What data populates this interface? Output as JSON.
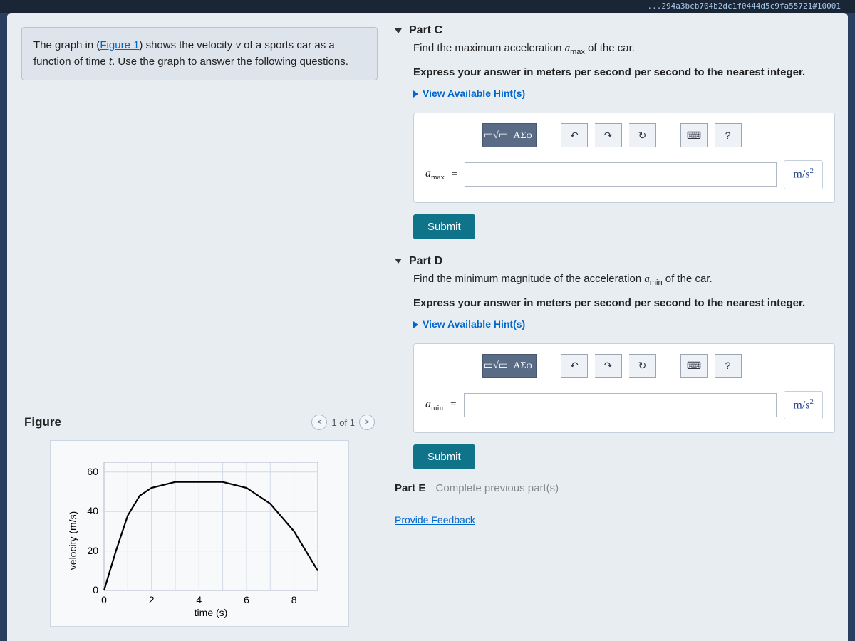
{
  "url_fragment": "...294a3bcb704b2dc1f0444d5c9fa55721#10001",
  "problem": {
    "prefix": "The graph in (",
    "figure_link": "Figure 1",
    "mid": ") shows the velocity ",
    "var_v": "v",
    "mid2": " of a sports car as a function of time ",
    "var_t": "t",
    "suffix": ". Use the graph to answer the following questions."
  },
  "figure": {
    "title": "Figure",
    "counter": "1 of 1",
    "ylabel": "velocity (m/s)",
    "xlabel": "time (s)",
    "y_ticks": [
      "0",
      "20",
      "40",
      "60"
    ],
    "x_ticks": [
      "0",
      "2",
      "4",
      "6",
      "8"
    ]
  },
  "chart_data": {
    "type": "line",
    "xlabel": "time (s)",
    "ylabel": "velocity (m/s)",
    "xlim": [
      0,
      9
    ],
    "ylim": [
      0,
      65
    ],
    "series": [
      {
        "name": "velocity",
        "x": [
          0,
          0.5,
          1,
          1.5,
          2,
          3,
          4,
          5,
          6,
          7,
          8,
          9
        ],
        "y": [
          0,
          20,
          38,
          48,
          52,
          55,
          55,
          55,
          52,
          44,
          30,
          10
        ]
      }
    ]
  },
  "parts": {
    "c": {
      "label": "Part C",
      "prompt_pre": "Find the maximum acceleration ",
      "prompt_var": "a",
      "prompt_sub": "max",
      "prompt_post": " of the car.",
      "instruct": "Express your answer in meters per second per second to the nearest integer.",
      "hint": "View Available Hint(s)",
      "var_label": "a",
      "var_sub": "max",
      "eq": "=",
      "unit": "m/s",
      "unit_sup": "2",
      "submit": "Submit"
    },
    "d": {
      "label": "Part D",
      "prompt_pre": "Find the minimum magnitude of the acceleration ",
      "prompt_var": "a",
      "prompt_sub": "min",
      "prompt_post": " of the car.",
      "instruct": "Express your answer in meters per second per second to the nearest integer.",
      "hint": "View Available Hint(s)",
      "var_label": "a",
      "var_sub": "min",
      "eq": "=",
      "unit": "m/s",
      "unit_sup": "2",
      "submit": "Submit"
    },
    "e": {
      "label": "Part E",
      "msg": "Complete previous part(s)"
    }
  },
  "toolbar": {
    "templates": "▭√▭",
    "greek": "ΑΣφ",
    "undo": "↶",
    "redo": "↷",
    "reset": "↻",
    "keyboard": "⌨",
    "help": "?"
  },
  "feedback": "Provide Feedback"
}
